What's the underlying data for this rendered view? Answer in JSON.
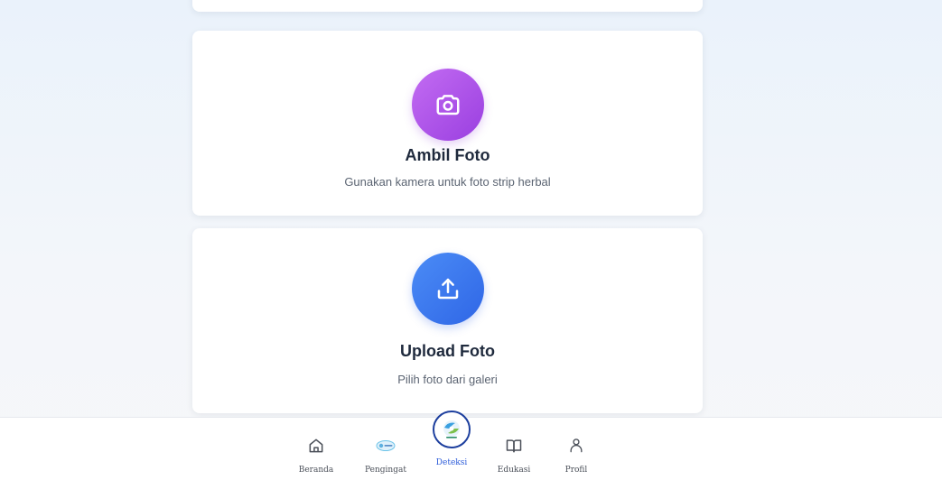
{
  "cards": [
    {
      "title": "Ambil Foto",
      "description": "Gunakan kamera untuk foto strip herbal",
      "icon": "camera-icon",
      "accent": "#a64fe8"
    },
    {
      "title": "Upload Foto",
      "description": "Pilih foto dari galeri",
      "icon": "upload-icon",
      "accent": "#3a78ee"
    }
  ],
  "bottom_nav": {
    "active": "Deteksi",
    "active_color": "#2b5bd9",
    "items": [
      {
        "label": "Beranda",
        "icon": "home-icon"
      },
      {
        "label": "Pengingat",
        "icon": "pengingat-logo-icon"
      },
      {
        "label": "Deteksi",
        "icon": "deteksi-logo-icon"
      },
      {
        "label": "Edukasi",
        "icon": "book-icon"
      },
      {
        "label": "Profil",
        "icon": "user-icon"
      }
    ]
  }
}
